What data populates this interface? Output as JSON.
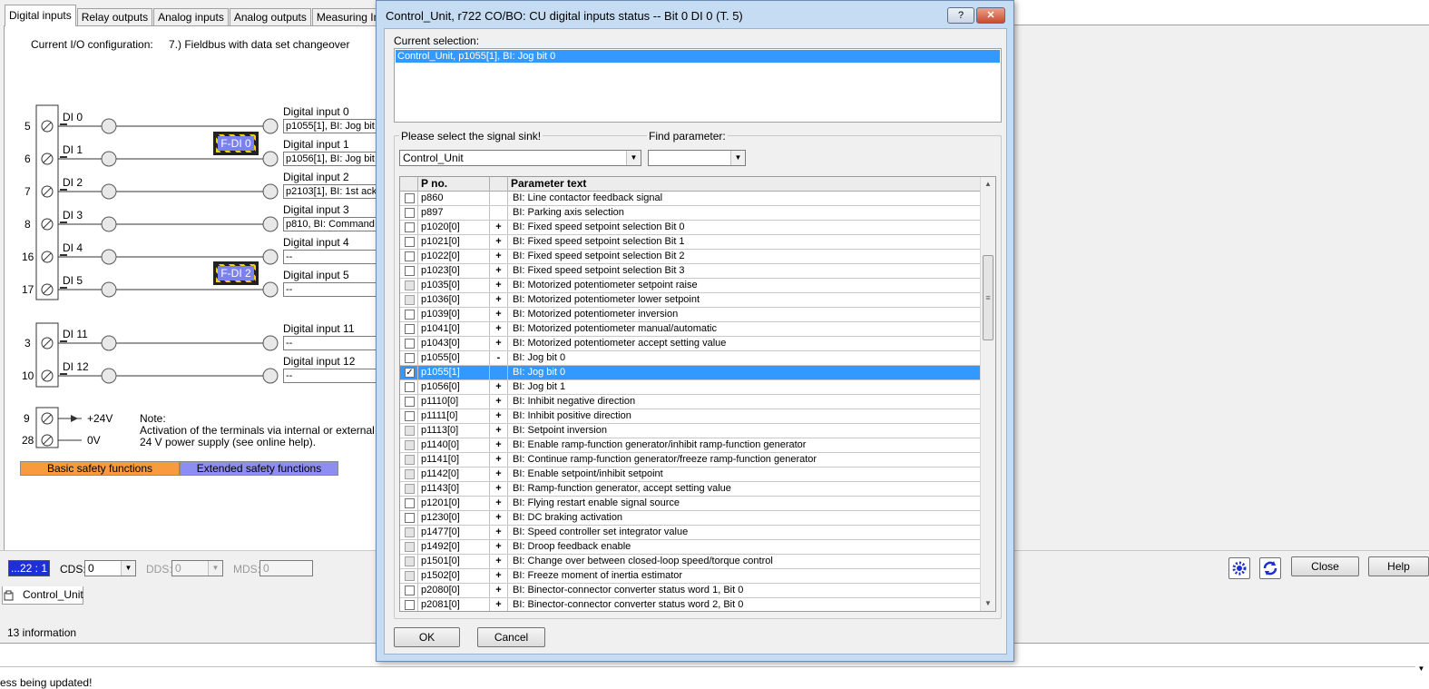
{
  "tabs": [
    "Digital inputs",
    "Relay outputs",
    "Analog inputs",
    "Analog outputs",
    "Measuring Input"
  ],
  "config": {
    "label": "Current I/O configuration:",
    "value": "7.) Fieldbus with data set changeover"
  },
  "inputs": [
    {
      "terminal": "5",
      "di": "DI 0",
      "title": "Digital input 0",
      "value": "p1055[1], BI: Jog bit"
    },
    {
      "terminal": "6",
      "di": "DI 1",
      "title": "Digital input 1",
      "value": "p1056[1], BI: Jog bit"
    },
    {
      "terminal": "7",
      "di": "DI 2",
      "title": "Digital input 2",
      "value": "p2103[1], BI: 1st ack"
    },
    {
      "terminal": "8",
      "di": "DI 3",
      "title": "Digital input 3",
      "value": "p810, BI: Command"
    },
    {
      "terminal": "16",
      "di": "DI 4",
      "title": "Digital input 4",
      "value": "--"
    },
    {
      "terminal": "17",
      "di": "DI 5",
      "title": "Digital input 5",
      "value": "--"
    },
    {
      "terminal": "3",
      "di": "DI 11",
      "title": "Digital input 11",
      "value": "--"
    },
    {
      "terminal": "10",
      "di": "DI 12",
      "title": "Digital input 12",
      "value": "--"
    }
  ],
  "fdi": [
    "F-DI 0",
    "F-DI 2"
  ],
  "supply": {
    "t9": "9",
    "t28": "28",
    "v24": "+24V",
    "v0": "0V"
  },
  "note": {
    "title": "Note:",
    "line1": "Activation of the terminals via internal or external",
    "line2": "24 V power supply (see online help)."
  },
  "legend": {
    "basic": "Basic safety functions",
    "extended": "Extended safety functions"
  },
  "bottom": {
    "counter": "...22 : 1",
    "cds_label": "CDS:",
    "cds": "0",
    "dds_label": "DDS:",
    "dds": "0",
    "mds_label": "MDS:",
    "mds": "0",
    "close": "Close",
    "help": "Help"
  },
  "tree": {
    "tab": "Control_Unit"
  },
  "info": "13 information",
  "status": "ess being updated!",
  "dialog": {
    "title": "Control_Unit, r722 CO/BO: CU digital inputs status -- Bit 0 DI 0 (T. 5)",
    "help_btn": "?",
    "close_btn": "✕",
    "current_label": "Current selection:",
    "current_item": "Control_Unit, p1055[1], BI: Jog bit 0",
    "sink_label": "Please select the signal sink!",
    "sink_value": "Control_Unit",
    "find_label": "Find parameter:",
    "find_value": "",
    "col_pno": "P no.",
    "col_text": "Parameter text",
    "ok": "OK",
    "cancel": "Cancel",
    "rows": [
      {
        "p": "p860",
        "e": "",
        "t": "BI: Line contactor feedback signal",
        "en": true,
        "chk": false
      },
      {
        "p": "p897",
        "e": "",
        "t": "BI: Parking axis selection",
        "en": true,
        "chk": false
      },
      {
        "p": "p1020[0]",
        "e": "+",
        "t": "BI: Fixed speed setpoint selection Bit 0",
        "en": true,
        "chk": false
      },
      {
        "p": "p1021[0]",
        "e": "+",
        "t": "BI: Fixed speed setpoint selection Bit 1",
        "en": true,
        "chk": false
      },
      {
        "p": "p1022[0]",
        "e": "+",
        "t": "BI: Fixed speed setpoint selection Bit 2",
        "en": true,
        "chk": false
      },
      {
        "p": "p1023[0]",
        "e": "+",
        "t": "BI: Fixed speed setpoint selection Bit 3",
        "en": true,
        "chk": false
      },
      {
        "p": "p1035[0]",
        "e": "+",
        "t": "BI: Motorized potentiometer setpoint raise",
        "en": false,
        "chk": false
      },
      {
        "p": "p1036[0]",
        "e": "+",
        "t": "BI: Motorized potentiometer lower setpoint",
        "en": false,
        "chk": false
      },
      {
        "p": "p1039[0]",
        "e": "+",
        "t": "BI: Motorized potentiometer inversion",
        "en": true,
        "chk": false
      },
      {
        "p": "p1041[0]",
        "e": "+",
        "t": "BI: Motorized potentiometer manual/automatic",
        "en": true,
        "chk": false
      },
      {
        "p": "p1043[0]",
        "e": "+",
        "t": "BI: Motorized potentiometer accept setting value",
        "en": true,
        "chk": false
      },
      {
        "p": "p1055[0]",
        "e": "-",
        "t": "BI: Jog bit 0",
        "en": true,
        "chk": false
      },
      {
        "p": "p1055[1]",
        "e": "",
        "t": "BI: Jog bit 0",
        "en": true,
        "chk": true,
        "sel": true
      },
      {
        "p": "p1056[0]",
        "e": "+",
        "t": "BI: Jog bit 1",
        "en": true,
        "chk": false
      },
      {
        "p": "p1110[0]",
        "e": "+",
        "t": "BI: Inhibit negative direction",
        "en": true,
        "chk": false
      },
      {
        "p": "p1111[0]",
        "e": "+",
        "t": "BI: Inhibit positive direction",
        "en": true,
        "chk": false
      },
      {
        "p": "p1113[0]",
        "e": "+",
        "t": "BI: Setpoint inversion",
        "en": false,
        "chk": false
      },
      {
        "p": "p1140[0]",
        "e": "+",
        "t": "BI: Enable ramp-function generator/inhibit ramp-function generator",
        "en": false,
        "chk": false
      },
      {
        "p": "p1141[0]",
        "e": "+",
        "t": "BI: Continue ramp-function generator/freeze ramp-function generator",
        "en": false,
        "chk": false
      },
      {
        "p": "p1142[0]",
        "e": "+",
        "t": "BI: Enable setpoint/inhibit setpoint",
        "en": false,
        "chk": false
      },
      {
        "p": "p1143[0]",
        "e": "+",
        "t": "BI: Ramp-function generator, accept setting value",
        "en": false,
        "chk": false
      },
      {
        "p": "p1201[0]",
        "e": "+",
        "t": "BI: Flying restart enable signal source",
        "en": true,
        "chk": false
      },
      {
        "p": "p1230[0]",
        "e": "+",
        "t": "BI: DC braking activation",
        "en": true,
        "chk": false
      },
      {
        "p": "p1477[0]",
        "e": "+",
        "t": "BI: Speed controller set integrator value",
        "en": false,
        "chk": false
      },
      {
        "p": "p1492[0]",
        "e": "+",
        "t": "BI: Droop feedback enable",
        "en": false,
        "chk": false
      },
      {
        "p": "p1501[0]",
        "e": "+",
        "t": "BI: Change over between closed-loop speed/torque control",
        "en": false,
        "chk": false
      },
      {
        "p": "p1502[0]",
        "e": "+",
        "t": "BI: Freeze moment of inertia estimator",
        "en": false,
        "chk": false
      },
      {
        "p": "p2080[0]",
        "e": "+",
        "t": "BI: Binector-connector converter status word 1, Bit 0",
        "en": true,
        "chk": false
      },
      {
        "p": "p2081[0]",
        "e": "+",
        "t": "BI: Binector-connector converter status word 2, Bit 0",
        "en": true,
        "chk": false
      }
    ]
  }
}
